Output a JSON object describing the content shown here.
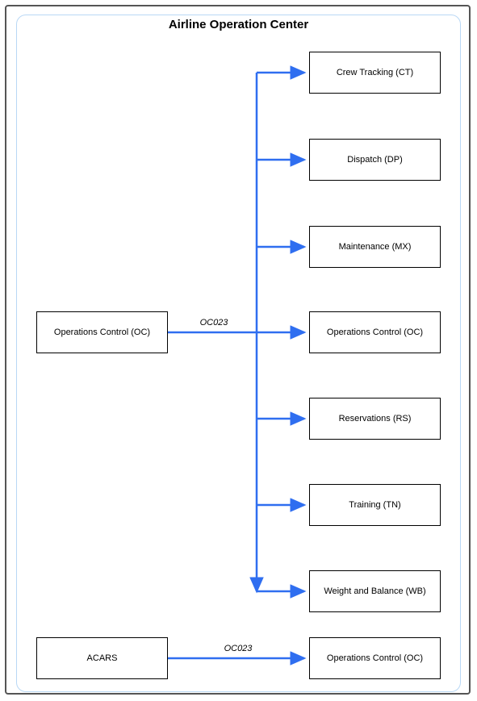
{
  "title": "Airline Operation Center",
  "source_box": "Operations Control (OC)",
  "edge_top_label": "OC023",
  "targets": [
    "Crew Tracking (CT)",
    "Dispatch (DP)",
    "Maintenance (MX)",
    "Operations Control (OC)",
    "Reservations (RS)",
    "Training (TN)",
    "Weight and Balance (WB)"
  ],
  "bottom_source": "ACARS",
  "bottom_edge_label": "OC023",
  "bottom_target": "Operations Control (OC)"
}
